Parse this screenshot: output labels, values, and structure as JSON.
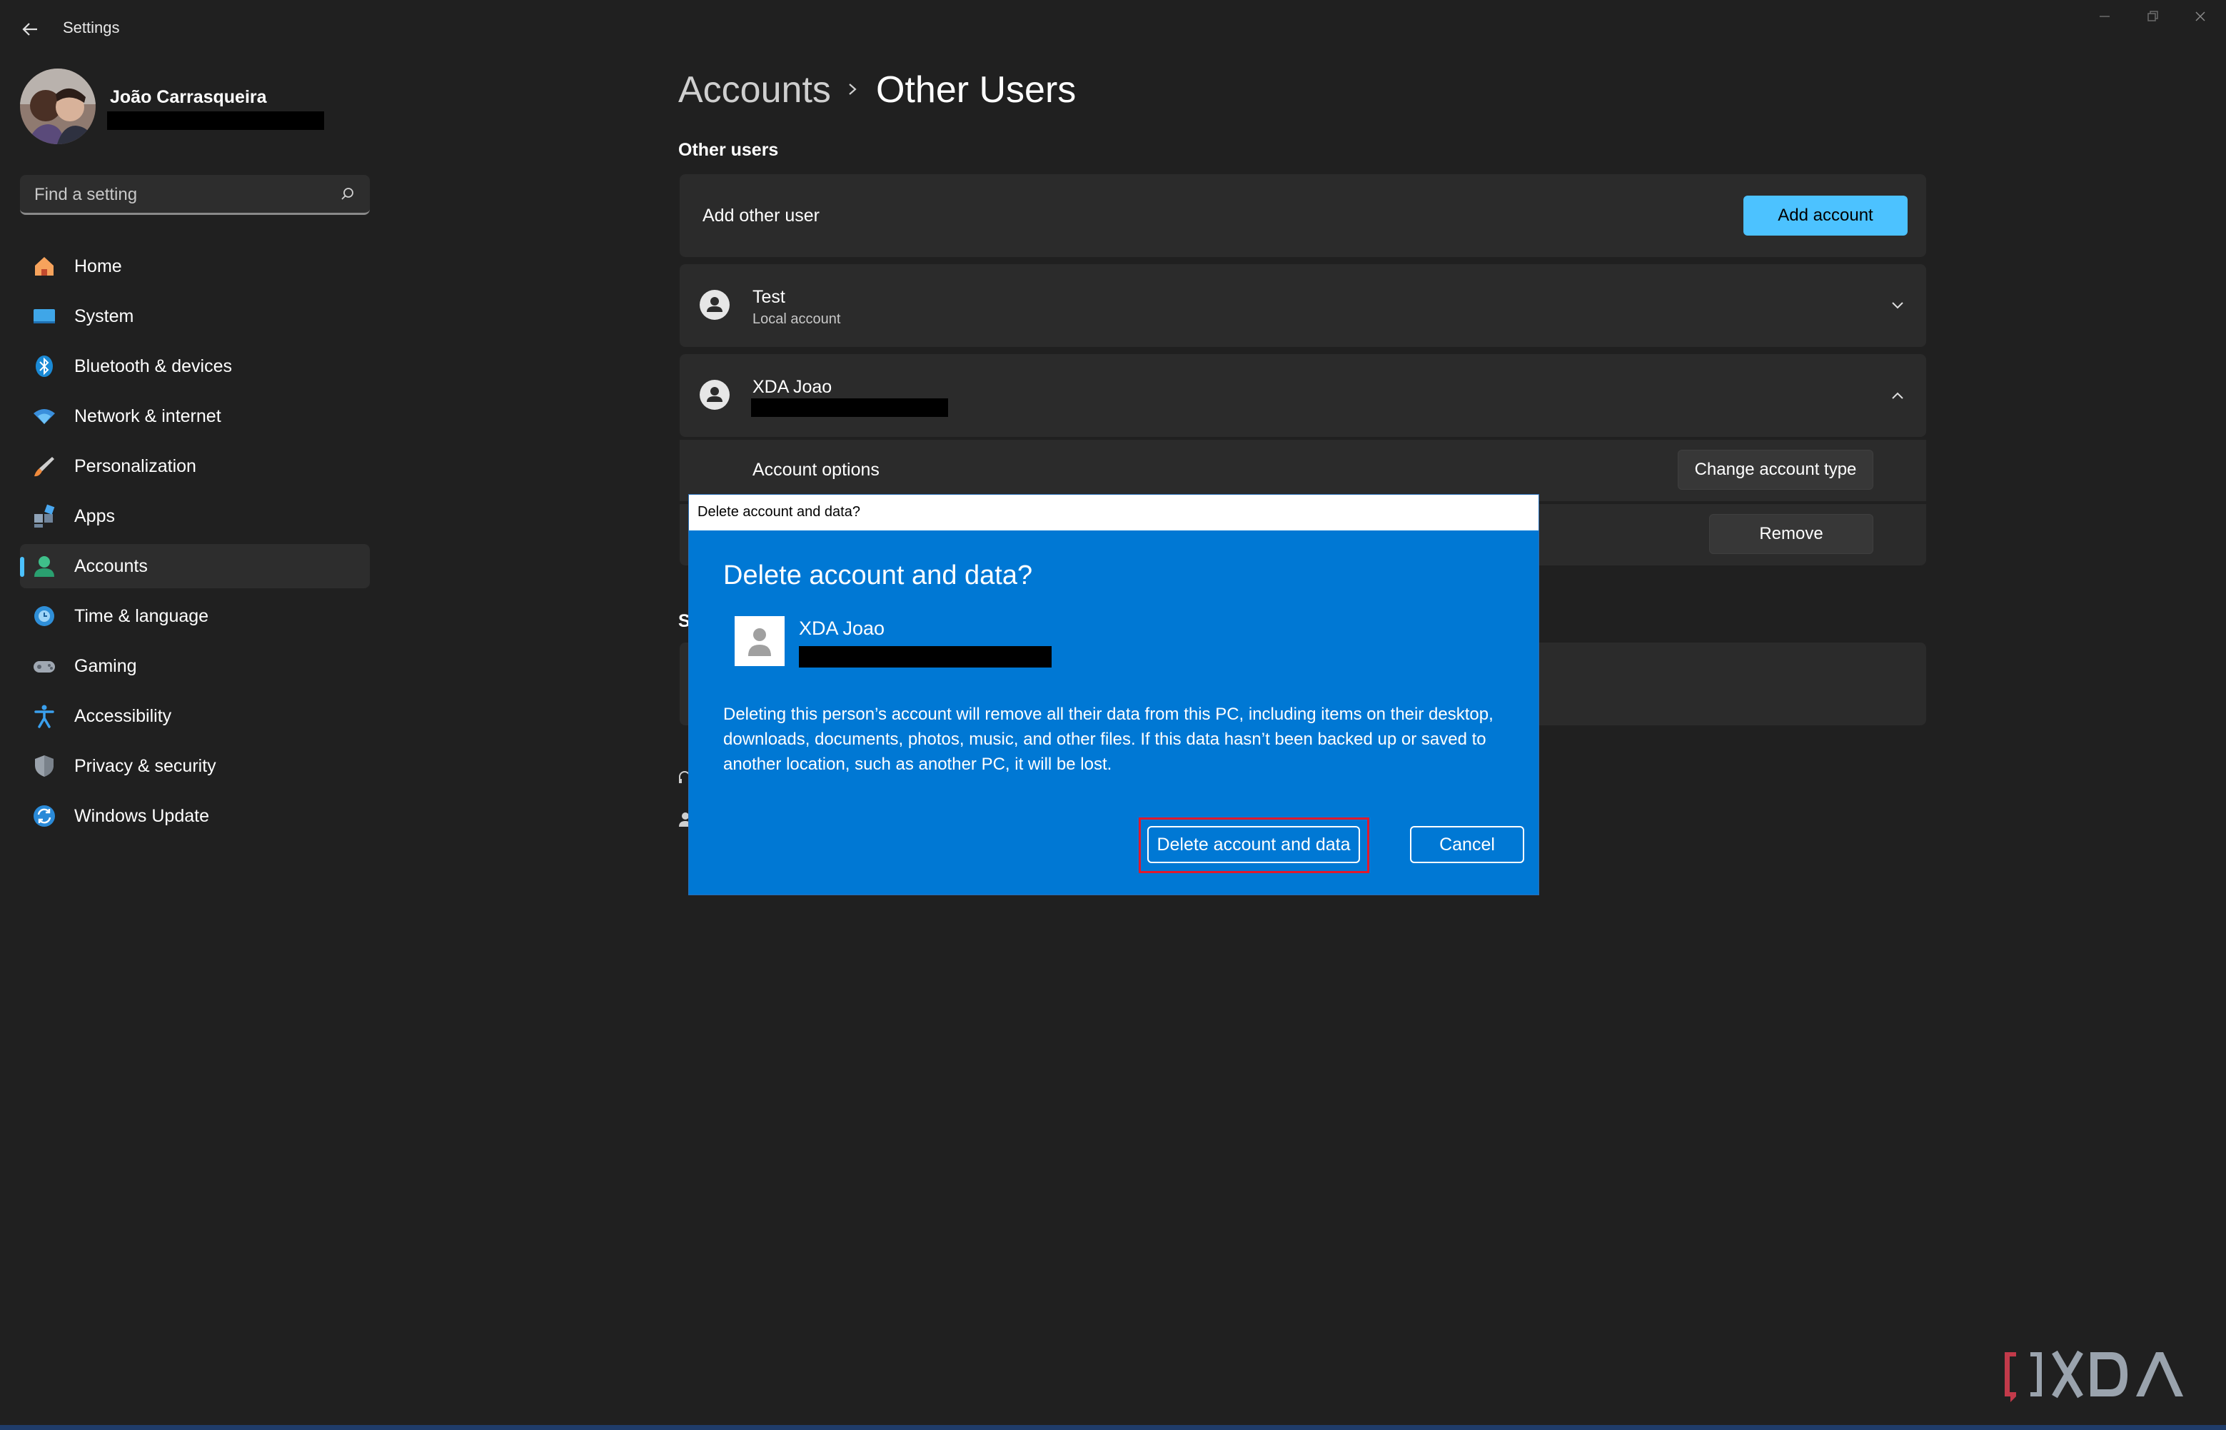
{
  "window": {
    "title": "Settings"
  },
  "profile": {
    "name": "João Carrasqueira"
  },
  "search": {
    "placeholder": "Find a setting"
  },
  "nav": [
    {
      "label": "Home",
      "icon": "home-icon"
    },
    {
      "label": "System",
      "icon": "system-icon"
    },
    {
      "label": "Bluetooth & devices",
      "icon": "bluetooth-icon"
    },
    {
      "label": "Network & internet",
      "icon": "wifi-icon"
    },
    {
      "label": "Personalization",
      "icon": "brush-icon"
    },
    {
      "label": "Apps",
      "icon": "apps-icon"
    },
    {
      "label": "Accounts",
      "icon": "accounts-icon",
      "active": true
    },
    {
      "label": "Time & language",
      "icon": "globe-clock-icon"
    },
    {
      "label": "Gaming",
      "icon": "gamepad-icon"
    },
    {
      "label": "Accessibility",
      "icon": "accessibility-icon"
    },
    {
      "label": "Privacy & security",
      "icon": "shield-icon"
    },
    {
      "label": "Windows Update",
      "icon": "update-icon"
    }
  ],
  "breadcrumb": {
    "parent": "Accounts",
    "current": "Other Users"
  },
  "main": {
    "section_title": "Other users",
    "add_row": {
      "label": "Add other user",
      "button": "Add account"
    },
    "users": [
      {
        "name": "Test",
        "subtitle": "Local account",
        "expanded": false
      },
      {
        "name": "XDA Joao",
        "subtitle": "",
        "expanded": true
      }
    ],
    "expanded_options": {
      "account_options_label": "Account options",
      "change_type_button": "Change account type",
      "remove_button": "Remove"
    },
    "partial_section_letter": "S"
  },
  "dialog": {
    "window_title": "Delete account and data?",
    "heading": "Delete account and data?",
    "user_name": "XDA Joao",
    "body": "Deleting this person’s account will remove all their data from this PC, including items on their desktop, downloads, documents, photos, music, and other files. If this data hasn’t been backed up or saved to another location, such as another PC, it will be lost.",
    "confirm_button": "Delete account and data",
    "cancel_button": "Cancel"
  },
  "colors": {
    "background": "#202020",
    "accent": "#4cc2ff",
    "dialog_blue": "#0078d4",
    "highlight_red": "#e0192d"
  }
}
